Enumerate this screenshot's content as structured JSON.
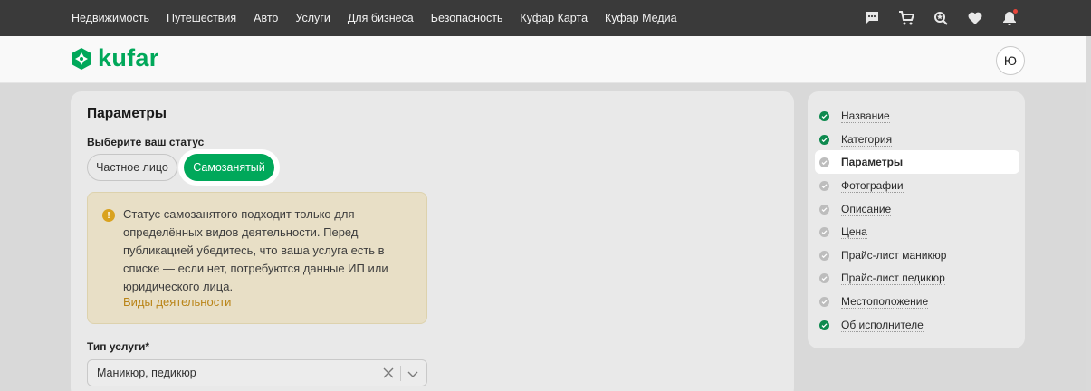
{
  "topnav": {
    "links": [
      "Недвижимость",
      "Путешествия",
      "Авто",
      "Услуги",
      "Для бизнеса",
      "Безопасность",
      "Куфар Карта",
      "Куфар Медиа"
    ],
    "icons": [
      "chat-icon",
      "cart-icon",
      "saved-search-icon",
      "heart-icon",
      "bell-icon"
    ]
  },
  "header": {
    "logo_text": "kufar",
    "avatar_letter": "Ю"
  },
  "form": {
    "section_title": "Параметры",
    "status_label": "Выберите ваш статус",
    "status_options": [
      "Частное лицо",
      "Самозанятый"
    ],
    "status_selected": "Самозанятый",
    "notice": {
      "text": "Статус самозанятого подходит только для определённых видов деятельности. Перед публикацией убедитесь, что ваша услуга есть в списке — если нет, потребуются данные ИП или юридического лица.",
      "link": "Виды деятельности"
    },
    "service_type_label": "Тип услуги*",
    "service_type_value": "Маникюр, педикюр"
  },
  "steps": [
    {
      "label": "Название",
      "state": "done"
    },
    {
      "label": "Категория",
      "state": "done"
    },
    {
      "label": "Параметры",
      "state": "active"
    },
    {
      "label": "Фотографии",
      "state": "todo"
    },
    {
      "label": "Описание",
      "state": "todo"
    },
    {
      "label": "Цена",
      "state": "todo"
    },
    {
      "label": "Прайс-лист маникюр",
      "state": "todo"
    },
    {
      "label": "Прайс-лист педикюр",
      "state": "todo"
    },
    {
      "label": "Местоположение",
      "state": "todo"
    },
    {
      "label": "Об исполнителе",
      "state": "done"
    }
  ],
  "colors": {
    "brand_green": "#00a85a",
    "nav_bg": "#3a3a3a",
    "notice_link": "#b98417",
    "warning_icon": "#d9a21f"
  }
}
